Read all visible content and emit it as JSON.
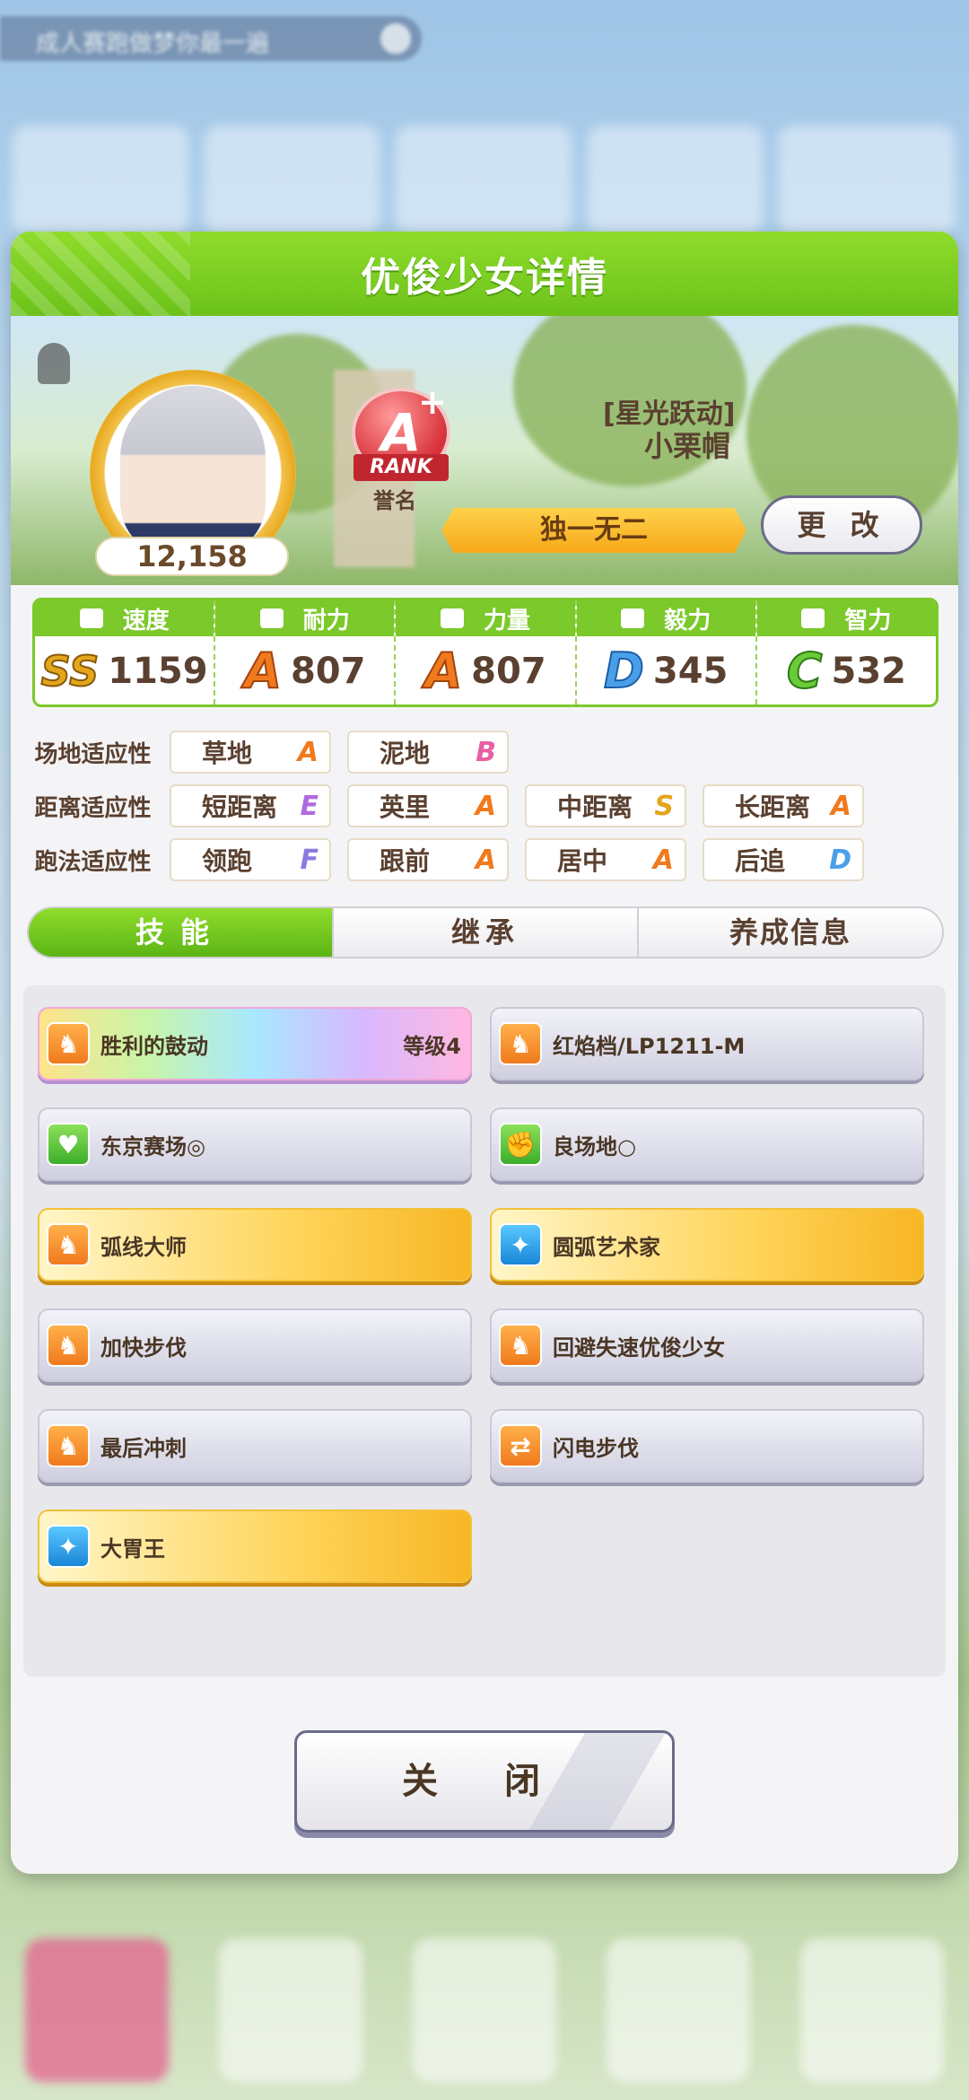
{
  "background": {
    "top_bar_text": "成人赛跑做梦你最一遍",
    "bottom_tiles": [
      "",
      "",
      "",
      "",
      ""
    ]
  },
  "dialog": {
    "title": "优俊少女详情",
    "fan_count": "12,158",
    "rank": {
      "letter": "A",
      "plus": "+",
      "word": "RANK"
    },
    "honor_label": "誉名",
    "char_title": "[星光跃动]",
    "char_name": "小栗帽",
    "epithet": "独一无二",
    "change_button": "更 改"
  },
  "stats": [
    {
      "label": "速度",
      "grade": "SS+",
      "grade_display": "SS",
      "value": "1159",
      "icon": "shoe-icon"
    },
    {
      "label": "耐力",
      "grade": "A",
      "grade_display": "A",
      "value": "807",
      "icon": "heart-icon"
    },
    {
      "label": "力量",
      "grade": "A",
      "grade_display": "A",
      "value": "807",
      "icon": "muscle-icon"
    },
    {
      "label": "毅力",
      "grade": "D",
      "grade_display": "D",
      "value": "345",
      "icon": "flame-icon"
    },
    {
      "label": "智力",
      "grade": "C+",
      "grade_display": "C",
      "value": "532",
      "icon": "graduation-cap-icon"
    }
  ],
  "aptitudes": {
    "track": {
      "label": "场地适应性",
      "items": [
        {
          "name": "草地",
          "grade": "A"
        },
        {
          "name": "泥地",
          "grade": "B"
        }
      ]
    },
    "distance": {
      "label": "距离适应性",
      "items": [
        {
          "name": "短距离",
          "grade": "E"
        },
        {
          "name": "英里",
          "grade": "A"
        },
        {
          "name": "中距离",
          "grade": "S"
        },
        {
          "name": "长距离",
          "grade": "A"
        }
      ]
    },
    "style": {
      "label": "跑法适应性",
      "items": [
        {
          "name": "领跑",
          "grade": "F"
        },
        {
          "name": "跟前",
          "grade": "A"
        },
        {
          "name": "居中",
          "grade": "A"
        },
        {
          "name": "后追",
          "grade": "D"
        }
      ]
    }
  },
  "tabs": [
    {
      "label": "技能",
      "active": true
    },
    {
      "label": "继承",
      "active": false
    },
    {
      "label": "养成信息",
      "active": false
    }
  ],
  "skills": [
    {
      "name": "胜利的鼓动",
      "level": "等级4",
      "style": "rainbow",
      "icon": "running-horse-icon"
    },
    {
      "name": "红焰档/LP1211-M",
      "level": "",
      "style": "normal",
      "icon": "running-horse-icon"
    },
    {
      "name": "东京赛场◎",
      "level": "",
      "style": "normal",
      "icon": "heart-icon"
    },
    {
      "name": "良场地○",
      "level": "",
      "style": "normal",
      "icon": "muscle-icon"
    },
    {
      "name": "弧线大师",
      "level": "",
      "style": "gold",
      "icon": "running-horse-icon"
    },
    {
      "name": "圆弧艺术家",
      "level": "",
      "style": "gold",
      "icon": "sparkle-icon"
    },
    {
      "name": "加快步伐",
      "level": "",
      "style": "normal",
      "icon": "running-horse-icon"
    },
    {
      "name": "回避失速优俊少女",
      "level": "",
      "style": "normal",
      "icon": "running-horse-icon"
    },
    {
      "name": "最后冲刺",
      "level": "",
      "style": "normal",
      "icon": "running-horse-icon"
    },
    {
      "name": "闪电步伐",
      "level": "",
      "style": "normal",
      "icon": "swap-arrows-icon"
    },
    {
      "name": "大胃王",
      "level": "",
      "style": "gold",
      "icon": "sparkle-icon"
    }
  ],
  "close_button": "关 闭"
}
